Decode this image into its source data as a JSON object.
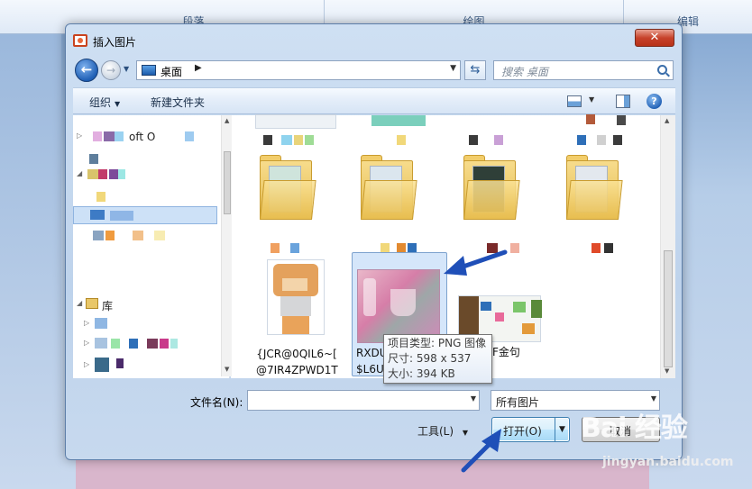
{
  "background": {
    "ribbon_groups": [
      "段落",
      "绘图",
      "编辑"
    ]
  },
  "dialog": {
    "title": "插入图片",
    "close_label": "✕",
    "address": {
      "location": "桌面",
      "search_placeholder": "搜索 桌面"
    },
    "toolbar": {
      "organize": "组织",
      "new_folder": "新建文件夹"
    },
    "nav": {
      "items": [
        {
          "label": "oft O"
        },
        {
          "label": "库"
        }
      ]
    },
    "files": {
      "items": [
        {
          "caption_line1": "{JCR@0QIL6~[",
          "caption_line2": "@7IR4ZPWD1T"
        },
        {
          "caption_line1": "RXDU",
          "caption_line2": "$L6U"
        },
        {
          "caption_line1": "F金句"
        }
      ]
    },
    "tooltip": {
      "line1": "项目类型: PNG 图像",
      "line2": "尺寸: 598 x 537",
      "line3": "大小: 394 KB"
    },
    "footer": {
      "filename_label": "文件名(N):",
      "filename_value": "",
      "filter_value": "所有图片",
      "tools_label": "工具(L)",
      "open_label": "打开(O)",
      "cancel_label": "取消"
    }
  },
  "watermark": {
    "logo": "Bai 经验",
    "site": "jingyan.baidu.com"
  },
  "colors": {
    "accent": "#1f4fb8",
    "selection": "#d5e6fa",
    "folder": "#f2cd6b"
  }
}
